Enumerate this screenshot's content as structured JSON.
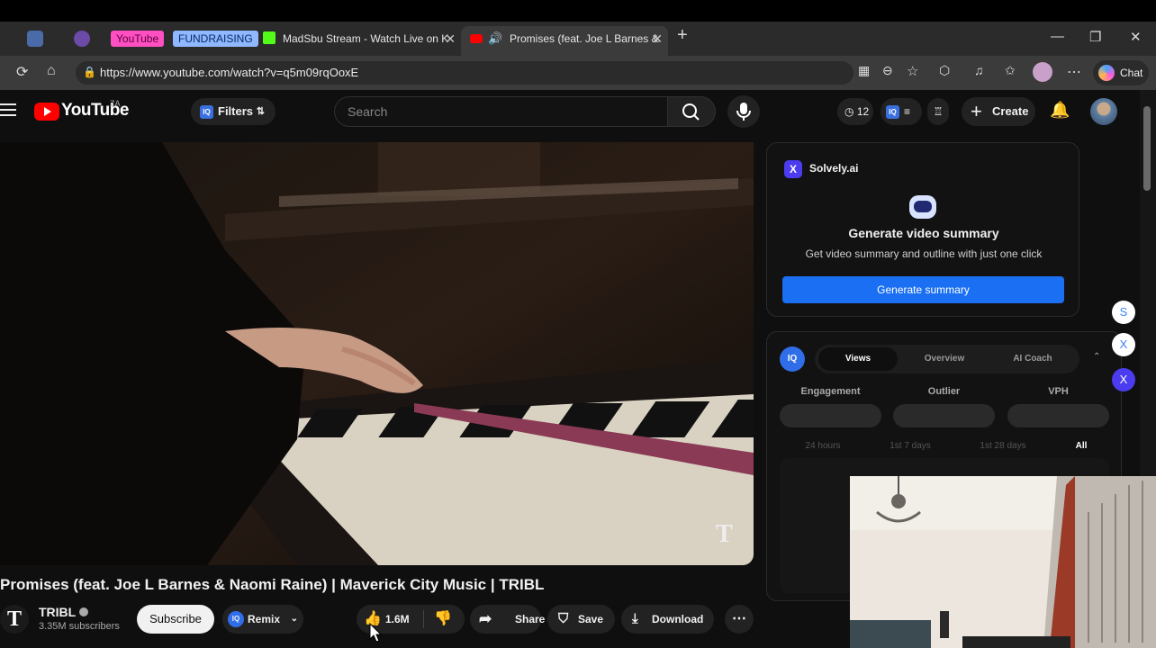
{
  "browser": {
    "pills": [
      "YouTube",
      "FUNDRAISING"
    ],
    "tabs": [
      {
        "title": "MadSbu Stream - Watch Live on K"
      },
      {
        "title": "Promises (feat. Joe L Barnes &"
      }
    ],
    "address": "https://www.youtube.com/watch?v=q5m09rqOoxE",
    "chat_label": "Chat"
  },
  "header": {
    "logo_text": "YouTube",
    "country": "ZA",
    "filters_label": "Filters",
    "iq_badge": "IQ",
    "search_placeholder": "Search",
    "counter": "12",
    "create_label": "Create"
  },
  "video": {
    "title": "Promises (feat. Joe L Barnes & Naomi Raine) | Maverick City Music | TRIBL",
    "watermark": "T"
  },
  "channel": {
    "logo_letter": "T",
    "name": "TRIBL",
    "subscribers": "3.35M subscribers",
    "subscribe_label": "Subscribe"
  },
  "actions": {
    "remix_label": "Remix",
    "likes": "1.6M",
    "share_label": "Share",
    "save_label": "Save",
    "download_label": "Download"
  },
  "solvely": {
    "brand_letter": "X",
    "brand": "Solvely.ai",
    "heading": "Generate video summary",
    "subheading": "Get video summary and outline with just one click",
    "button_label": "Generate summary"
  },
  "vidiq": {
    "badge": "IQ",
    "tabs": [
      "Views",
      "Overview",
      "AI Coach"
    ],
    "metrics": [
      "Engagement",
      "Outlier",
      "VPH"
    ],
    "ranges": [
      "24 hours",
      "1st 7 days",
      "1st 28 days",
      "All"
    ]
  },
  "side_chips": [
    "S",
    "X",
    "X"
  ],
  "colors": {
    "accent": "#1a6ff2",
    "youtube_red": "#ff0000",
    "solvely": "#4b3cf0",
    "vidiq": "#2f6ee8"
  }
}
